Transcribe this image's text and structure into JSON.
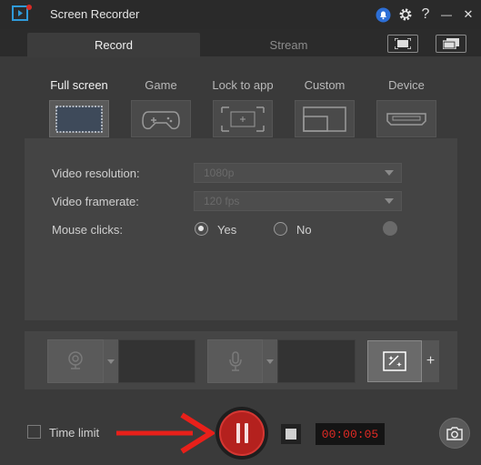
{
  "titlebar": {
    "title": "Screen Recorder",
    "help_label": "?",
    "minimize_label": "—",
    "close_label": "✕"
  },
  "tabs": [
    {
      "label": "Record",
      "active": true
    },
    {
      "label": "Stream",
      "active": false
    }
  ],
  "modes": [
    {
      "label": "Full screen",
      "icon": "fullscreen-icon",
      "active": true
    },
    {
      "label": "Game",
      "icon": "gamepad-icon",
      "active": false
    },
    {
      "label": "Lock to app",
      "icon": "lock-to-app-icon",
      "active": false
    },
    {
      "label": "Custom",
      "icon": "custom-area-icon",
      "active": false
    },
    {
      "label": "Device",
      "icon": "device-icon",
      "active": false
    }
  ],
  "settings": {
    "resolution_label": "Video resolution:",
    "resolution_value": "1080p",
    "framerate_label": "Video framerate:",
    "framerate_value": "120 fps",
    "mouse_clicks_label": "Mouse clicks:",
    "mouse_yes": "Yes",
    "mouse_no": "No",
    "mouse_selected": "Yes"
  },
  "devices": {
    "webcam_icon": "webcam-icon",
    "mic_icon": "microphone-icon",
    "effects_icon": "effects-icon",
    "add_label": "+"
  },
  "bottom": {
    "time_limit_label": "Time limit",
    "time_limit_checked": false,
    "timer": "00:00:05",
    "recording_state": "recording"
  },
  "colors": {
    "record_red": "#b4211e",
    "timer_red": "#e02a24",
    "annotation_arrow": "#e8201a",
    "notification_blue": "#2d6fd6",
    "app_icon_blue": "#2f9ad8"
  }
}
